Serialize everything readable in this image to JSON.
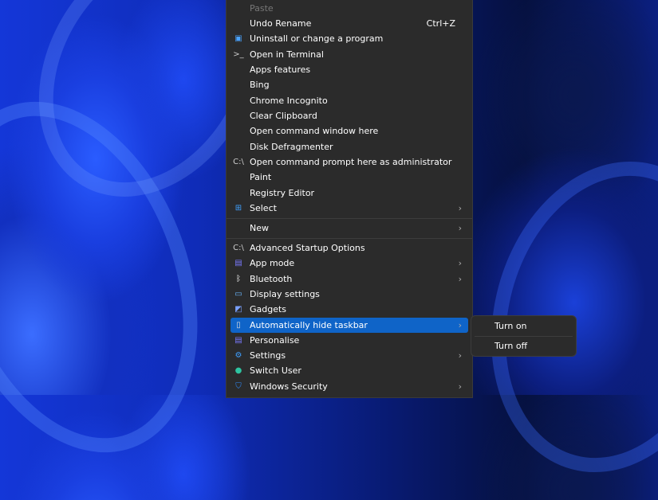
{
  "context_menu": {
    "items_top": [
      {
        "label": "Paste",
        "disabled": true
      },
      {
        "label": "Undo Rename",
        "shortcut": "Ctrl+Z"
      },
      {
        "label": "Uninstall or change a program",
        "icon": "programs-icon"
      },
      {
        "label": "Open in Terminal",
        "icon": "terminal-icon"
      },
      {
        "label": "Apps  features"
      },
      {
        "label": "Bing"
      },
      {
        "label": "Chrome Incognito"
      },
      {
        "label": "Clear Clipboard"
      },
      {
        "label": "Open command window here"
      },
      {
        "label": "Disk Defragmenter"
      },
      {
        "label": "Open command prompt here as administrator",
        "icon": "cmd-icon"
      },
      {
        "label": "Paint"
      },
      {
        "label": "Registry Editor"
      },
      {
        "label": "Select",
        "icon": "windows-icon",
        "submenu": true
      }
    ],
    "new": {
      "label": "New",
      "submenu": true
    },
    "items_bottom": [
      {
        "label": "Advanced Startup Options",
        "icon": "cmd-icon"
      },
      {
        "label": "App mode",
        "icon": "app-mode-icon",
        "submenu": true
      },
      {
        "label": "Bluetooth",
        "icon": "bluetooth-icon",
        "submenu": true
      },
      {
        "label": "Display settings",
        "icon": "display-icon"
      },
      {
        "label": "Gadgets",
        "icon": "gadgets-icon"
      },
      {
        "label": "Automatically hide taskbar",
        "icon": "taskbar-icon",
        "submenu": true,
        "highlighted": true
      },
      {
        "label": "Personalise",
        "icon": "personalise-icon"
      },
      {
        "label": "Settings",
        "icon": "settings-icon",
        "submenu": true
      },
      {
        "label": "Switch User",
        "icon": "user-icon"
      },
      {
        "label": "Windows Security",
        "icon": "shield-icon",
        "submenu": true
      }
    ]
  },
  "submenu": {
    "items": [
      "Turn on",
      "Turn off"
    ]
  },
  "colors": {
    "menu_bg": "#2b2b2b",
    "highlight": "#0f64c8"
  }
}
